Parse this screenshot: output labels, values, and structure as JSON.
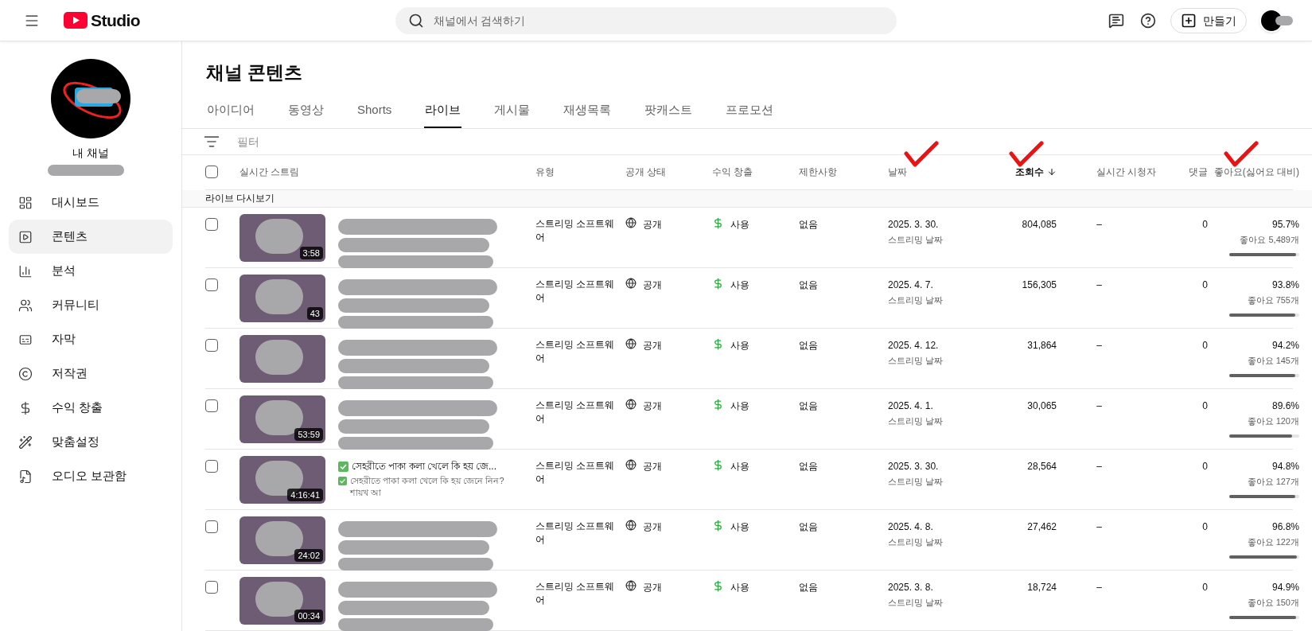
{
  "header": {
    "logo_text": "Studio",
    "search": {
      "placeholder": "채널에서 검색하기"
    },
    "create_button": "만들기"
  },
  "sidebar": {
    "channel_label": "내 채널",
    "items": [
      {
        "label": "대시보드",
        "selected": false
      },
      {
        "label": "콘텐츠",
        "selected": true
      },
      {
        "label": "분석",
        "selected": false
      },
      {
        "label": "커뮤니티",
        "selected": false
      },
      {
        "label": "자막",
        "selected": false
      },
      {
        "label": "저작권",
        "selected": false
      },
      {
        "label": "수익 창출",
        "selected": false
      },
      {
        "label": "맞춤설정",
        "selected": false
      },
      {
        "label": "오디오 보관함",
        "selected": false
      }
    ]
  },
  "page_title": "채널 콘텐츠",
  "tabs": [
    {
      "label": "아이디어",
      "selected": false
    },
    {
      "label": "동영상",
      "selected": false
    },
    {
      "label": "Shorts",
      "selected": false
    },
    {
      "label": "라이브",
      "selected": true
    },
    {
      "label": "게시물",
      "selected": false
    },
    {
      "label": "재생목록",
      "selected": false
    },
    {
      "label": "팟캐스트",
      "selected": false
    },
    {
      "label": "프로모션",
      "selected": false
    }
  ],
  "filter": {
    "placeholder": "필터"
  },
  "table": {
    "select_all_checked": false,
    "columns": [
      {
        "label": "실시간 스트림",
        "sorted": false,
        "marked": false
      },
      {
        "label": "유형",
        "sorted": false,
        "marked": false
      },
      {
        "label": "공개 상태",
        "sorted": false,
        "marked": false
      },
      {
        "label": "수익 창출",
        "sorted": false,
        "marked": false
      },
      {
        "label": "제한사항",
        "sorted": false,
        "marked": false
      },
      {
        "label": "날짜",
        "sorted": false,
        "marked": true
      },
      {
        "label": "조회수",
        "sorted": true,
        "marked": true
      },
      {
        "label": "실시간 시청자",
        "sorted": false,
        "marked": false
      },
      {
        "label": "댓글",
        "sorted": false,
        "marked": false
      },
      {
        "label": "좋아요(싫어요 대비)",
        "sorted": false,
        "marked": true
      }
    ],
    "group": "라이브 다시보기",
    "rows": [
      {
        "selected": false,
        "duration": "3:58",
        "type": "스트리밍 소프트웨어",
        "visibility": "공개",
        "monetization": "사용",
        "restriction": "없음",
        "date": "2025. 3. 30.",
        "date_label": "스트리밍 날짜",
        "views": "804,085",
        "live_viewers": "–",
        "comments": "0",
        "like_ratio": "95.7%",
        "likes": "좋아요 5,489개",
        "level": 0.957
      },
      {
        "selected": false,
        "duration": "43",
        "type": "스트리밍 소프트웨어",
        "visibility": "공개",
        "monetization": "사용",
        "restriction": "없음",
        "date": "2025. 4. 7.",
        "date_label": "스트리밍 날짜",
        "views": "156,305",
        "live_viewers": "–",
        "comments": "0",
        "like_ratio": "93.8%",
        "likes": "좋아요 755개",
        "level": 0.938
      },
      {
        "selected": false,
        "type": "스트리밍 소프트웨어",
        "visibility": "공개",
        "monetization": "사용",
        "restriction": "없음",
        "date": "2025. 4. 12.",
        "date_label": "스트리밍 날짜",
        "views": "31,864",
        "live_viewers": "–",
        "comments": "0",
        "like_ratio": "94.2%",
        "likes": "좋아요 145개",
        "level": 0.942
      },
      {
        "selected": false,
        "duration": "53:59",
        "type": "스트리밍 소프트웨어",
        "visibility": "공개",
        "monetization": "사용",
        "restriction": "없음",
        "date": "2025. 4. 1.",
        "date_label": "스트리밍 날짜",
        "views": "30,065",
        "live_viewers": "–",
        "comments": "0",
        "like_ratio": "89.6%",
        "likes": "좋아요 120개",
        "level": 0.896
      },
      {
        "selected": false,
        "duration": "4:16:41",
        "title": "সেহরীতে পাকা কলা খেলে কি হয় জে...",
        "description": "সেহরীতে পাকা কলা খেলে কি হয় জেনে নিন? শায়খ আ",
        "type": "스트리밍 소프트웨어",
        "visibility": "공개",
        "monetization": "사용",
        "restriction": "없음",
        "date": "2025. 3. 30.",
        "date_label": "스트리밍 날짜",
        "views": "28,564",
        "live_viewers": "–",
        "comments": "0",
        "like_ratio": "94.8%",
        "likes": "좋아요 127개",
        "level": 0.948
      },
      {
        "selected": false,
        "duration": "24:02",
        "type": "스트리밍 소프트웨어",
        "visibility": "공개",
        "monetization": "사용",
        "restriction": "없음",
        "date": "2025. 4. 8.",
        "date_label": "스트리밍 날짜",
        "views": "27,462",
        "live_viewers": "–",
        "comments": "0",
        "like_ratio": "96.8%",
        "likes": "좋아요 122개",
        "level": 0.968
      },
      {
        "selected": false,
        "duration": "00:34",
        "type": "스트리밍 소프트웨어",
        "visibility": "공개",
        "monetization": "사용",
        "restriction": "없음",
        "date": "2025. 3. 8.",
        "date_label": "스트리밍 날짜",
        "views": "18,724",
        "live_viewers": "–",
        "comments": "0",
        "like_ratio": "94.9%",
        "likes": "좋아요 150개",
        "level": 0.949
      }
    ]
  }
}
